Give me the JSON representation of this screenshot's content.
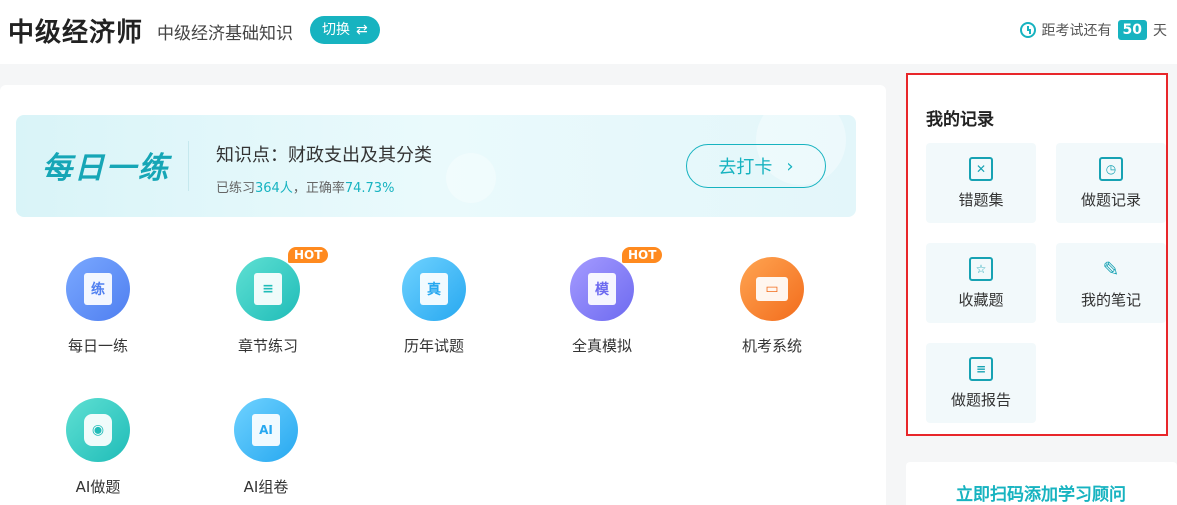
{
  "header": {
    "app_title": "中级经济师",
    "subject": "中级经济基础知识",
    "switch_label": "切换",
    "countdown_prefix": "距考试还有",
    "days": "50",
    "days_suffix": "天"
  },
  "daily": {
    "logo": "每日一练",
    "knowledge": "知识点：财政支出及其分类",
    "stats_prefix": "已练习",
    "count": "364人",
    "stats_mid": "，正确率",
    "accuracy": "74.73%",
    "checkin_label": "去打卡"
  },
  "features": [
    {
      "label": "每日一练",
      "glyph": "练",
      "hot": ""
    },
    {
      "label": "章节练习",
      "glyph": "≡",
      "hot": "HOT"
    },
    {
      "label": "历年试题",
      "glyph": "真",
      "hot": ""
    },
    {
      "label": "全真模拟",
      "glyph": "模",
      "hot": "HOT"
    },
    {
      "label": "机考系统",
      "glyph": "▭",
      "hot": ""
    },
    {
      "label": "AI做题",
      "glyph": "◉",
      "hot": ""
    },
    {
      "label": "AI组卷",
      "glyph": "AI",
      "hot": ""
    }
  ],
  "records": {
    "title": "我的记录",
    "items": [
      {
        "label": "错题集",
        "icon": "wrong-book-icon",
        "glyph": "✕"
      },
      {
        "label": "做题记录",
        "icon": "record-clock-icon",
        "glyph": "◷"
      },
      {
        "label": "收藏题",
        "icon": "star-icon",
        "glyph": "☆"
      },
      {
        "label": "我的笔记",
        "icon": "pencil-icon",
        "glyph": "✎"
      },
      {
        "label": "做题报告",
        "icon": "report-icon",
        "glyph": "≡"
      }
    ]
  },
  "advisor": {
    "label": "立即扫码添加学习顾问"
  },
  "colors": {
    "accent": "#17b3c0",
    "hot": "#ff8a1f",
    "highlight_border": "#e8262a"
  }
}
